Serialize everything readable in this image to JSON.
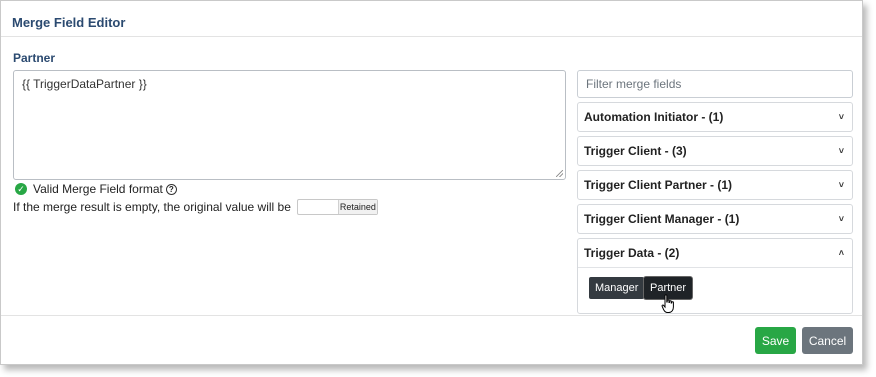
{
  "dialog": {
    "title": "Merge Field Editor"
  },
  "field": {
    "label": "Partner",
    "value": "{{ TriggerDataPartner }}"
  },
  "validation": {
    "text": "Valid Merge Field format",
    "check_icon": "✓",
    "help_icon": "?"
  },
  "empty_result": {
    "text": "If the merge result is empty, the original value will be",
    "toggle_label": "Retained"
  },
  "filter": {
    "placeholder": "Filter merge fields"
  },
  "groups": [
    {
      "label": "Automation Initiator - (1)",
      "expanded": false,
      "chevron": "˅"
    },
    {
      "label": "Trigger Client - (3)",
      "expanded": false,
      "chevron": "˅"
    },
    {
      "label": "Trigger Client Partner - (1)",
      "expanded": false,
      "chevron": "˅"
    },
    {
      "label": "Trigger Client Manager - (1)",
      "expanded": false,
      "chevron": "˅"
    },
    {
      "label": "Trigger Data - (2)",
      "expanded": true,
      "chevron": "˄",
      "items": [
        "Manager",
        "Partner"
      ]
    }
  ],
  "footer": {
    "save_label": "Save",
    "cancel_label": "Cancel"
  },
  "colors": {
    "accent_title": "#2b4a70",
    "success": "#28a745",
    "secondary": "#6c757d",
    "dark_button": "#343a40"
  }
}
